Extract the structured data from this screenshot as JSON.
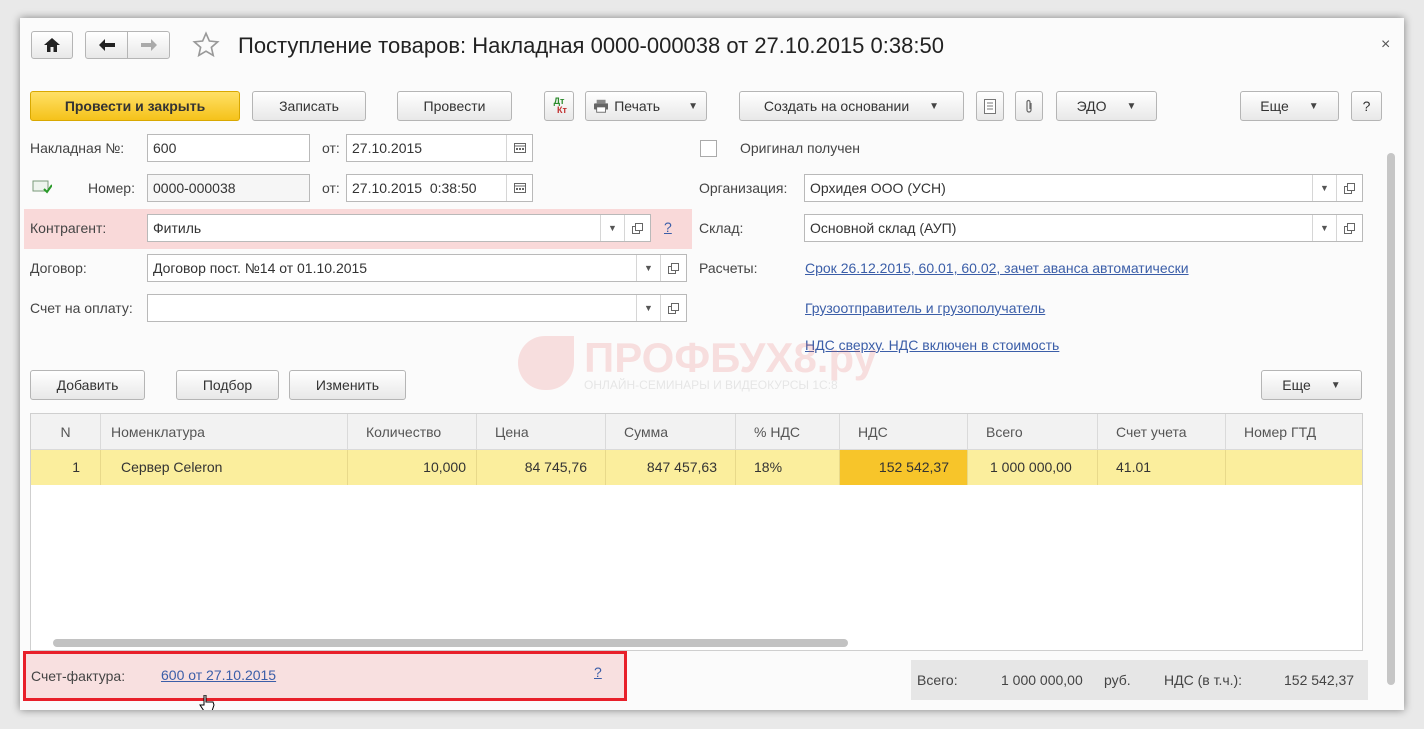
{
  "window": {
    "title": "Поступление товаров: Накладная 0000-000038 от 27.10.2015 0:38:50"
  },
  "toolbar": {
    "post_close": "Провести и закрыть",
    "save": "Записать",
    "post": "Провести",
    "dt_kt_top": "Дт",
    "dt_kt_bottom": "Кт",
    "print": "Печать",
    "create_based": "Создать на основании",
    "edo": "ЭДО",
    "more": "Еще",
    "help": "?"
  },
  "form": {
    "invoice_no_label": "Накладная №:",
    "invoice_no_value": "600",
    "from_label": "от:",
    "invoice_date": "27.10.2015",
    "number_label": "Номер:",
    "number_value": "0000-000038",
    "number_datetime": "27.10.2015  0:38:50",
    "counterparty_label": "Контрагент:",
    "counterparty_value": "Фитиль",
    "counterparty_help": "?",
    "contract_label": "Договор:",
    "contract_value": "Договор пост. №14 от 01.10.2015",
    "payment_invoice_label": "Счет на оплату:",
    "payment_invoice_value": "",
    "original_received_label": "Оригинал получен",
    "organization_label": "Организация:",
    "organization_value": "Орхидея ООО (УСН)",
    "warehouse_label": "Склад:",
    "warehouse_value": "Основной склад (АУП)",
    "settlements_label": "Расчеты:",
    "settlements_link": "Срок 26.12.2015, 60.01, 60.02, зачет аванса автоматически",
    "shipper_link": "Грузоотправитель и грузополучатель",
    "vat_link": "НДС сверху. НДС включен в стоимость"
  },
  "watermark": {
    "brand": "ПРОФБУХ8.ру",
    "tagline": "ОНЛАЙН-СЕМИНАРЫ И ВИДЕОКУРСЫ 1С:8"
  },
  "table_toolbar": {
    "add": "Добавить",
    "pick": "Подбор",
    "edit": "Изменить",
    "more": "Еще"
  },
  "table": {
    "columns": [
      "N",
      "Номенклатура",
      "Количество",
      "Цена",
      "Сумма",
      "% НДС",
      "НДС",
      "Всего",
      "Счет учета",
      "Номер ГТД"
    ],
    "rows": [
      {
        "n": "1",
        "item": "Сервер Celeron",
        "qty": "10,000",
        "price": "84 745,76",
        "sum": "847 457,63",
        "vat_rate": "18%",
        "vat": "152 542,37",
        "total": "1 000 000,00",
        "account": "41.01",
        "gtd": ""
      }
    ]
  },
  "footer": {
    "invoice_label": "Счет-фактура:",
    "invoice_link": "600 от 27.10.2015",
    "invoice_help": "?",
    "total_label": "Всего:",
    "total_value": "1 000 000,00",
    "currency": "руб.",
    "vat_label": "НДС (в т.ч.):",
    "vat_value": "152 542,37"
  },
  "colors": {
    "primary_button": "#f5c21a",
    "selected_row": "#fbee9d",
    "highlight_cell": "#f7c52a",
    "link": "#3b5ea8",
    "red_frame": "#e8202a"
  }
}
